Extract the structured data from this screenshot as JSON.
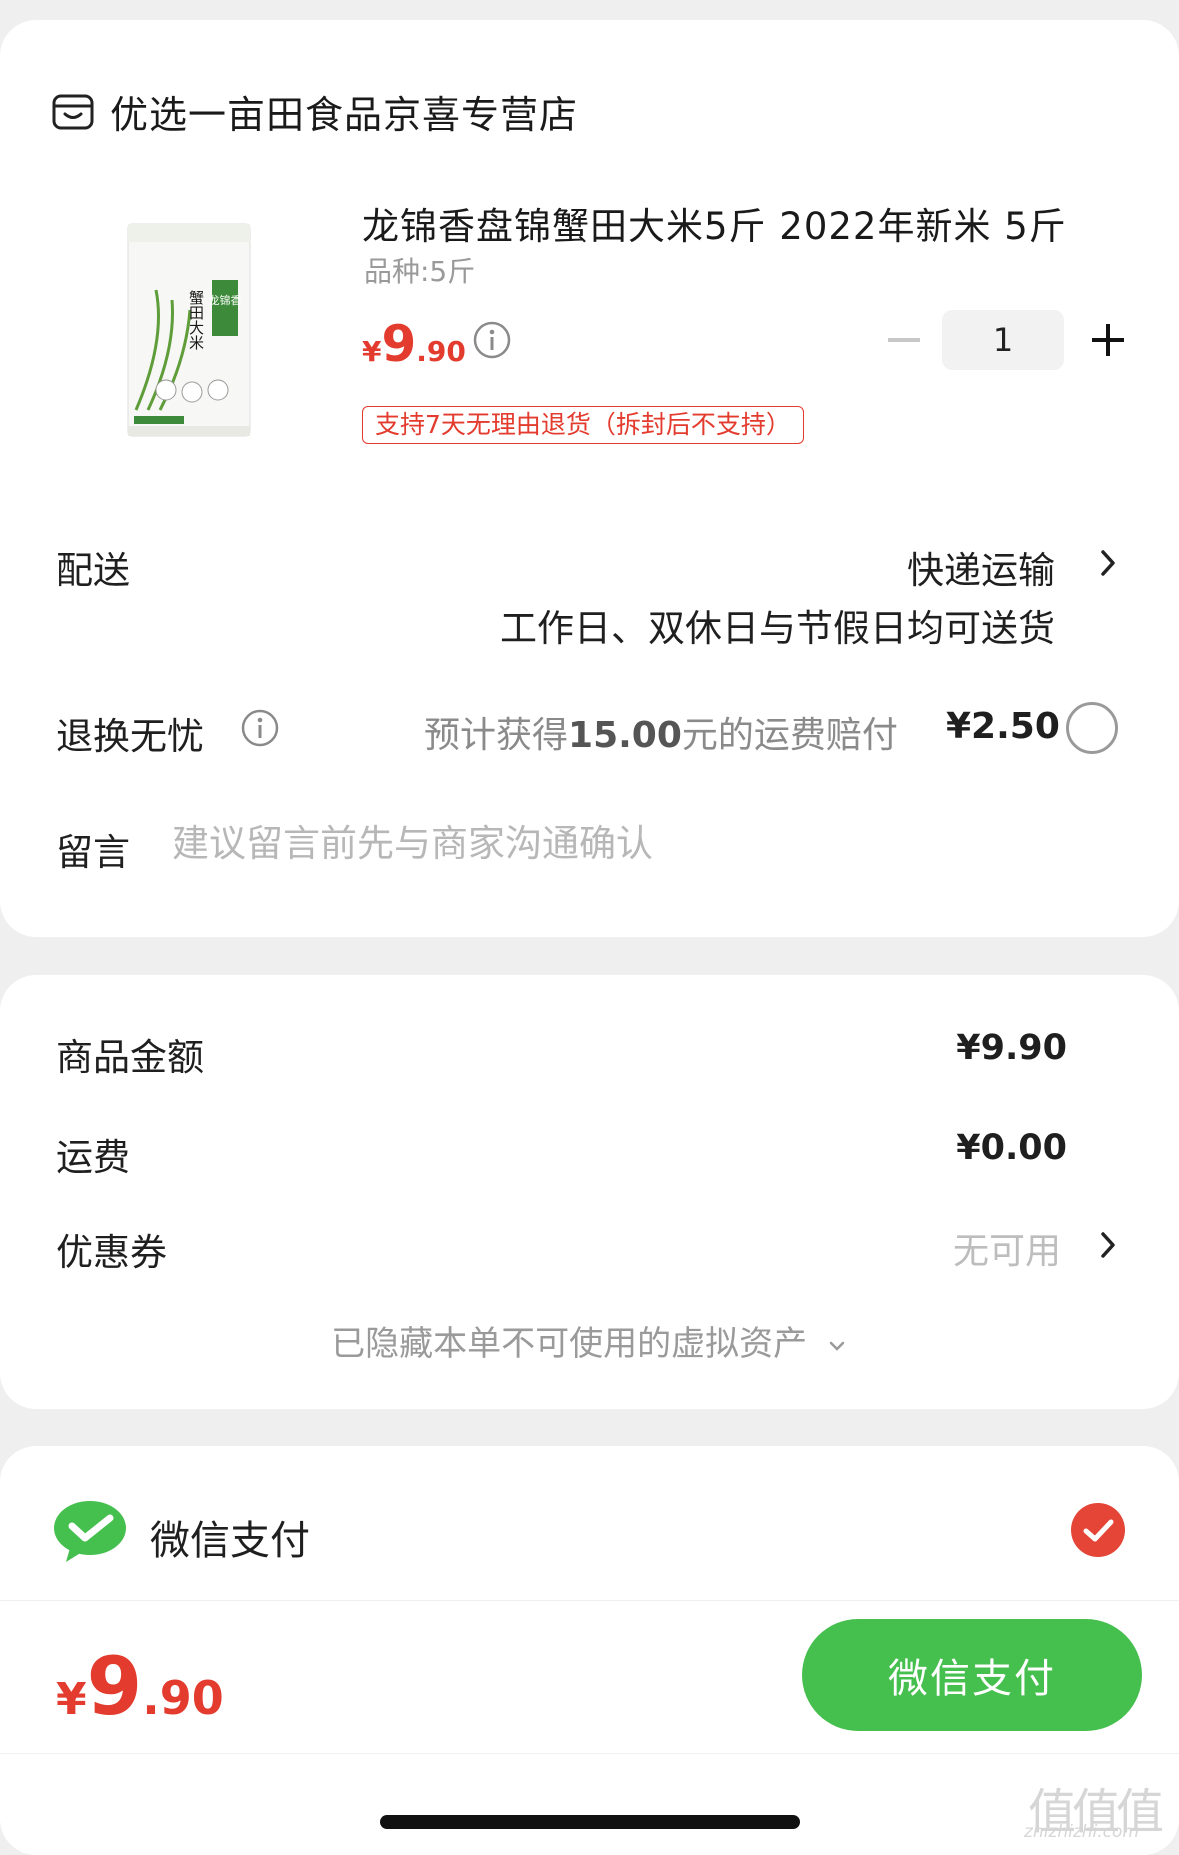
{
  "store": {
    "name": "优选一亩田食品京喜专营店",
    "icon": "store-icon"
  },
  "product": {
    "title": "龙锦香盘锦蟹田大米5斤 2022年新米 5斤",
    "spec": "品种:5斤",
    "price": {
      "currency": "¥",
      "integer": "9",
      "decimal": ".90"
    },
    "quantity": "1",
    "return_tag": "支持7天无理由退货（拆封后不支持）",
    "image_text": {
      "brand": "龙锦香",
      "name": "蟹田大米"
    }
  },
  "delivery": {
    "label": "配送",
    "method": "快递运输",
    "note": "工作日、双休日与节假日均可送货"
  },
  "return_insurance": {
    "label": "退换无忧",
    "text_prefix": "预计获得",
    "amount": "15.00",
    "text_suffix": "元的运费赔付",
    "price": "¥2.50",
    "selected": false
  },
  "message": {
    "label": "留言",
    "placeholder": "建议留言前先与商家沟通确认",
    "value": ""
  },
  "summary": {
    "goods_label": "商品金额",
    "goods_value": "¥9.90",
    "shipping_label": "运费",
    "shipping_value": "¥0.00",
    "coupon_label": "优惠券",
    "coupon_value": "无可用",
    "hidden_note": "已隐藏本单不可使用的虚拟资产"
  },
  "payment": {
    "method": "微信支付",
    "selected": true,
    "total": {
      "currency": "¥",
      "integer": "9",
      "decimal": ".90"
    },
    "button_label": "微信支付"
  },
  "watermark": {
    "logo": "值值值",
    "domain": "zhizhizhi.com"
  },
  "colors": {
    "price_red": "#e33b2e",
    "wechat_green": "#45bf4e",
    "check_red": "#e44536"
  }
}
